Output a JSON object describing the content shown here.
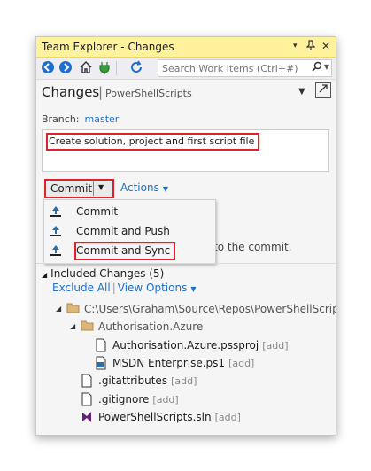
{
  "window": {
    "title": "Team Explorer - Changes",
    "controls": [
      "▾",
      "⊐",
      "✕"
    ]
  },
  "toolbar": {
    "search_placeholder": "Search Work Items (Ctrl+#)"
  },
  "header": {
    "title": "Changes",
    "separator": "|",
    "repo": "PowerShellScripts"
  },
  "branch": {
    "label": "Branch:",
    "name": "master"
  },
  "commit_message": "Create solution, project and first script file",
  "commit_button": {
    "label": "Commit"
  },
  "actions_link": "Actions",
  "background_text": "to the commit.",
  "commit_menu": {
    "items": [
      {
        "label": "Commit"
      },
      {
        "label": "Commit and Push"
      },
      {
        "label": "Commit and Sync"
      }
    ]
  },
  "included": {
    "title": "Included Changes (5)",
    "exclude_all": "Exclude All",
    "view_options": "View Options"
  },
  "tree": {
    "root": "C:\\Users\\Graham\\Source\\Repos\\PowerShellScripts",
    "folder": "Authorisation.Azure",
    "files": [
      {
        "name": "Authorisation.Azure.pssproj",
        "tag": "[add]"
      },
      {
        "name": "MSDN Enterprise.ps1",
        "tag": "[add]"
      },
      {
        "name": ".gitattributes",
        "tag": "[add]"
      },
      {
        "name": ".gitignore",
        "tag": "[add]"
      },
      {
        "name": "PowerShellScripts.sln",
        "tag": "[add]"
      }
    ]
  },
  "colors": {
    "titlebar": "#fff29d",
    "link": "#1e6fcc",
    "highlight_border": "#e0202a"
  }
}
